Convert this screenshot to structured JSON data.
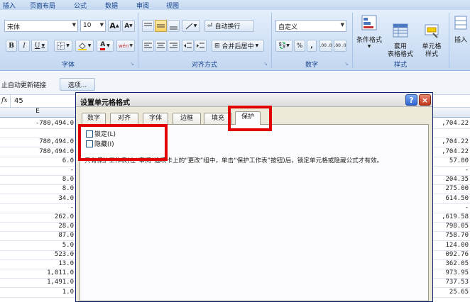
{
  "ribbon": {
    "tabs": [
      "插入",
      "页面布局",
      "公式",
      "数据",
      "审阅",
      "视图"
    ],
    "font": {
      "name": "宋体",
      "size": "10",
      "grow_label": "A",
      "shrink_label": "A",
      "bold": "B",
      "italic": "I",
      "underline": "U",
      "color_a": "A",
      "phonetic": "wén",
      "group_label": "字体"
    },
    "align": {
      "wrap_label": "自动换行",
      "merge_label": "合并后居中",
      "group_label": "对齐方式"
    },
    "number": {
      "format": "自定义",
      "percent": "%",
      "comma": ",",
      "inc_decimal": ".00 .0",
      "dec_decimal": ".00 .0",
      "group_label": "数字"
    },
    "styles": {
      "conditional": "条件格式",
      "table": "套用\n表格格式",
      "cell": "单元格\n样式",
      "group_label": "样式"
    },
    "cells": {
      "insert": "插入"
    }
  },
  "linkbar": {
    "text": "止自动更新链接",
    "options_button": "选项..."
  },
  "formula": {
    "fx": "fx",
    "value": "45"
  },
  "sheet": {
    "column_label": "E",
    "left_values": [
      "-780,494.0",
      "",
      "780,494.0",
      "780,494.0",
      "6.0",
      "-",
      "8.0",
      "8.0",
      "34.0",
      "-",
      "262.0",
      "28.0",
      "87.0",
      "5.0",
      "523.0",
      "13.0",
      "1,011.0",
      "1,491.0",
      "1.0"
    ],
    "right_values": [
      ",704.22",
      "",
      ",704.22",
      ",704.22",
      "57.00",
      "-",
      "204.35",
      "275.00",
      "614.50",
      "-",
      ",619.58",
      "798.05",
      "758.70",
      "124.00",
      "092.76",
      "362.05",
      "973.95",
      "737.53",
      "25.65"
    ]
  },
  "dialog": {
    "title": "设置单元格格式",
    "help": "?",
    "close": "×",
    "tabs": [
      "数字",
      "对齐",
      "字体",
      "边框",
      "填充",
      "保护"
    ],
    "locked_label": "锁定(L)",
    "hidden_label": "隐藏(I)",
    "note": "只有保护工作表(在“审阅”选项卡上的“更改”组中，单击“保护工作表”按钮)后，锁定单元格或隐藏公式才有效。"
  },
  "colors": {
    "highlight_red": "#e00000",
    "ribbon_text": "#15428b",
    "dialog_bg": "#ece9d8"
  }
}
